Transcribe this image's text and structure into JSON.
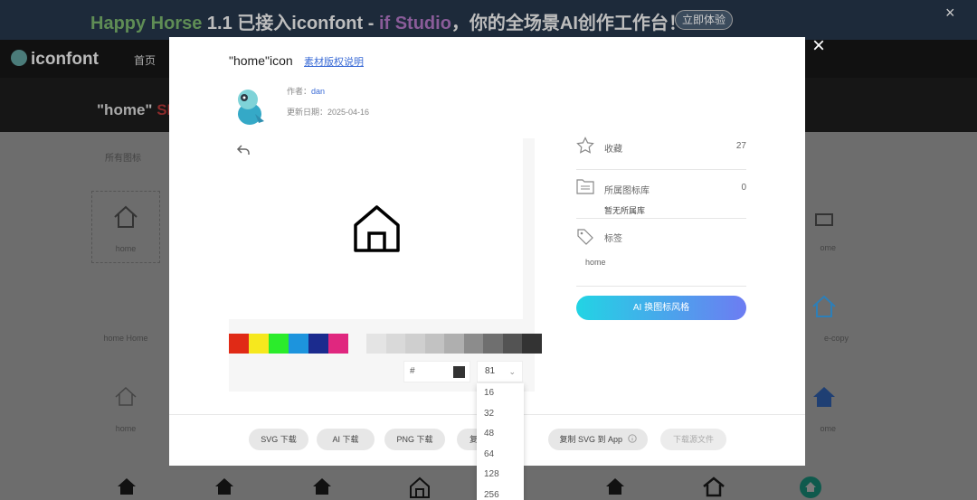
{
  "banner": {
    "text_part1": "Happy Horse",
    "text_part2": " 1.1 已接入iconfont - ",
    "text_part3": "if Studio",
    "text_part4": "，你的全场景AI创作工作台！",
    "cta": "立即体验",
    "close": "×"
  },
  "topnav": {
    "logo": "iconfont",
    "home": "首页"
  },
  "hero": {
    "title_prefix": "\"home\"",
    "title_suffix": " SE"
  },
  "filter": {
    "label": "所有图标"
  },
  "bg_cards": [
    {
      "label": "home"
    },
    {
      "label": "home Home"
    },
    {
      "label": "home"
    },
    {
      "label": "ome"
    },
    {
      "label": "e-copy"
    },
    {
      "label": "ome"
    }
  ],
  "modal": {
    "close": "×",
    "title": "\"home\"icon",
    "copyright_link": "素材版权说明",
    "author_label": "作者：",
    "author": "dan",
    "updated_label": "更新日期：",
    "updated": "2025-04-16",
    "hex_prefix": "#",
    "size_value": "81",
    "size_chevron": "⌄"
  },
  "colors": {
    "swatches": [
      "#e02a16",
      "#f6e81e",
      "#2bec2b",
      "#1d94dd",
      "#1b2b8e",
      "#e0277f"
    ],
    "grays": [
      "#e4e4e4",
      "#d9d9d9",
      "#cfcfcf",
      "#c2c2c2",
      "#afafaf",
      "#8c8c8c",
      "#6f6f6f",
      "#535353",
      "#333333"
    ],
    "ai_gradient": [
      "#22d4e4",
      "#6d7cf2"
    ],
    "link": "#3a6bd6"
  },
  "side": {
    "collect_label": "收藏",
    "collect_count": "27",
    "library_label": "所属图标库",
    "library_count": "0",
    "no_library": "暂无所属库",
    "tag_label": "标签",
    "tag": "home",
    "ai_button": "AI 换图标风格"
  },
  "footer": {
    "svg": "SVG 下载",
    "ai": "AI 下载",
    "png": "PNG 下载",
    "copy_partial": "复",
    "copy_svg_app": "复制 SVG 到 App",
    "source": "下载源文件"
  },
  "dropdown": {
    "options": [
      "16",
      "32",
      "48",
      "64",
      "128",
      "256"
    ]
  },
  "icons": {
    "star": "star-icon",
    "library": "folder-icon",
    "tag": "tag-icon",
    "undo": "undo-icon",
    "house": "home-icon",
    "info": "info-icon"
  }
}
